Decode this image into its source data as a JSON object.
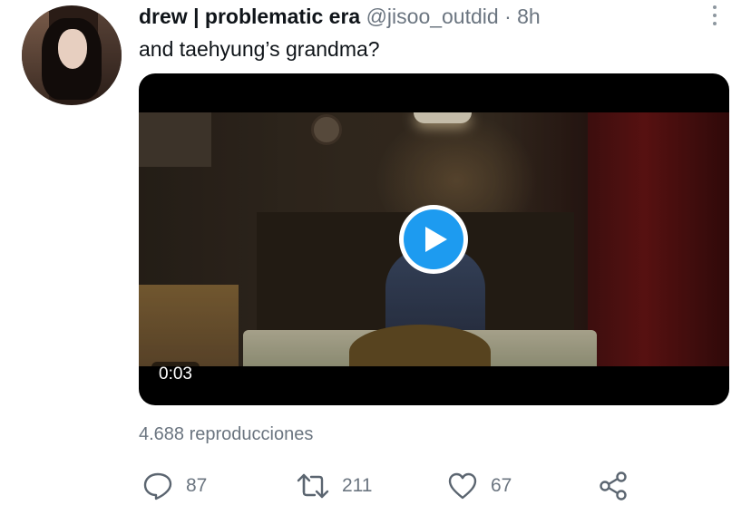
{
  "tweet": {
    "author_name": "drew | problematic era",
    "handle": "@jisoo_outdid",
    "separator": "·",
    "time": "8h",
    "text": "and taehyung’s grandma?",
    "video": {
      "duration": "0:03",
      "play_icon": "play-icon"
    },
    "views": "4.688 reproducciones",
    "actions": {
      "reply_count": "87",
      "retweet_count": "211",
      "like_count": "67"
    }
  },
  "colors": {
    "accent": "#1d9bf0",
    "secondary_text": "#6b7580",
    "primary_text": "#0f1419"
  }
}
